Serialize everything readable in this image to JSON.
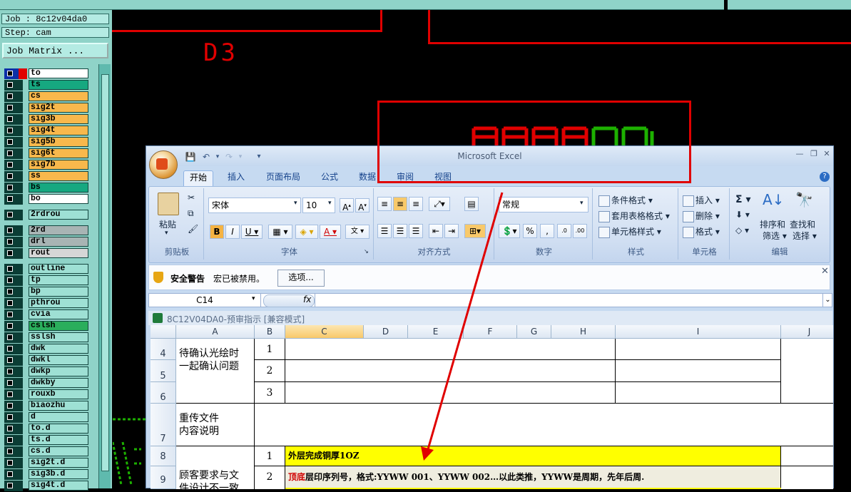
{
  "cam": {
    "job": "Job : 8c12v04da0",
    "step": "Step: cam",
    "job_matrix": "Job Matrix ...",
    "drawing_label": "D3",
    "layers": [
      {
        "name": "to",
        "color": "white"
      },
      {
        "name": "ts",
        "color": "teal"
      },
      {
        "name": "cs",
        "color": "orange"
      },
      {
        "name": "sig2t",
        "color": "orange"
      },
      {
        "name": "sig3b",
        "color": "orange"
      },
      {
        "name": "sig4t",
        "color": "orange"
      },
      {
        "name": "sig5b",
        "color": "orange"
      },
      {
        "name": "sig6t",
        "color": "orange"
      },
      {
        "name": "sig7b",
        "color": "orange"
      },
      {
        "name": "ss",
        "color": "orange"
      },
      {
        "name": "bs",
        "color": "teal"
      },
      {
        "name": "bo",
        "color": "white"
      },
      {
        "name": "2rdrou",
        "color": "aqua"
      },
      {
        "name": "2rd",
        "color": "grey"
      },
      {
        "name": "drl",
        "color": "grey"
      },
      {
        "name": "rout",
        "color": "lgrey"
      },
      {
        "name": "outline",
        "color": "aqua"
      },
      {
        "name": "tp",
        "color": "aqua"
      },
      {
        "name": "bp",
        "color": "aqua"
      },
      {
        "name": "pthrou",
        "color": "aqua"
      },
      {
        "name": "cvia",
        "color": "aqua"
      },
      {
        "name": "cslsh",
        "color": "green"
      },
      {
        "name": "sslsh",
        "color": "aqua"
      },
      {
        "name": "dwk",
        "color": "aqua"
      },
      {
        "name": "dwkl",
        "color": "aqua"
      },
      {
        "name": "dwkp",
        "color": "aqua"
      },
      {
        "name": "dwkby",
        "color": "aqua"
      },
      {
        "name": "rouxb",
        "color": "aqua"
      },
      {
        "name": "biaozhu",
        "color": "aqua"
      },
      {
        "name": "d",
        "color": "aqua"
      },
      {
        "name": "to.d",
        "color": "aqua"
      },
      {
        "name": "ts.d",
        "color": "aqua"
      },
      {
        "name": "cs.d",
        "color": "aqua"
      },
      {
        "name": "sig2t.d",
        "color": "aqua"
      },
      {
        "name": "sig3b.d",
        "color": "aqua"
      },
      {
        "name": "sig4t.d",
        "color": "aqua"
      }
    ]
  },
  "excel": {
    "title": "Microsoft Excel",
    "tabs": [
      "开始",
      "插入",
      "页面布局",
      "公式",
      "数据",
      "审阅",
      "视图"
    ],
    "ribbon": {
      "paste": "粘贴",
      "clipboard": "剪贴板",
      "font_name": "宋体",
      "font_size": "10",
      "font_group": "字体",
      "align_group": "对齐方式",
      "number_format": "常规",
      "number_group": "数字",
      "cond_format": "条件格式",
      "table_format": "套用表格格式",
      "cell_style": "单元格样式",
      "style_group": "样式",
      "insert": "插入",
      "delete": "删除",
      "format": "格式",
      "cells_group": "单元格",
      "sort_filter_1": "排序和",
      "sort_filter_2": "筛选",
      "find_select_1": "查找和",
      "find_select_2": "选择",
      "edit_group": "编辑"
    },
    "security": {
      "title": "安全警告",
      "message": "宏已被禁用。",
      "button": "选项..."
    },
    "name_box": "C14",
    "fx": "fx",
    "doc_title": "8C12V04DA0-预审指示  [兼容模式]",
    "columns": [
      "A",
      "B",
      "C",
      "D",
      "E",
      "F",
      "G",
      "H",
      "I",
      "J"
    ],
    "row_numbers": [
      "4",
      "5",
      "6",
      "7",
      "8",
      "9"
    ],
    "cells": {
      "a_confirm_1": "待确认光绘时",
      "a_confirm_2": "一起确认问题",
      "b1": "1",
      "b2": "2",
      "b3": "3",
      "a_reupload_1": "重传文件",
      "a_reupload_2": "内容说明",
      "a_customer_1": "顾客要求与文",
      "a_customer_2": "件设计不一致",
      "r8_num": "1",
      "r8_text": "外层完成铜厚1OZ",
      "r9_num": "2",
      "r9_red": "顶底",
      "r9_text": "层印序列号，格式:YYWW 001、YYWW 002…以此类推，YYWW是周期，先年后周."
    }
  }
}
